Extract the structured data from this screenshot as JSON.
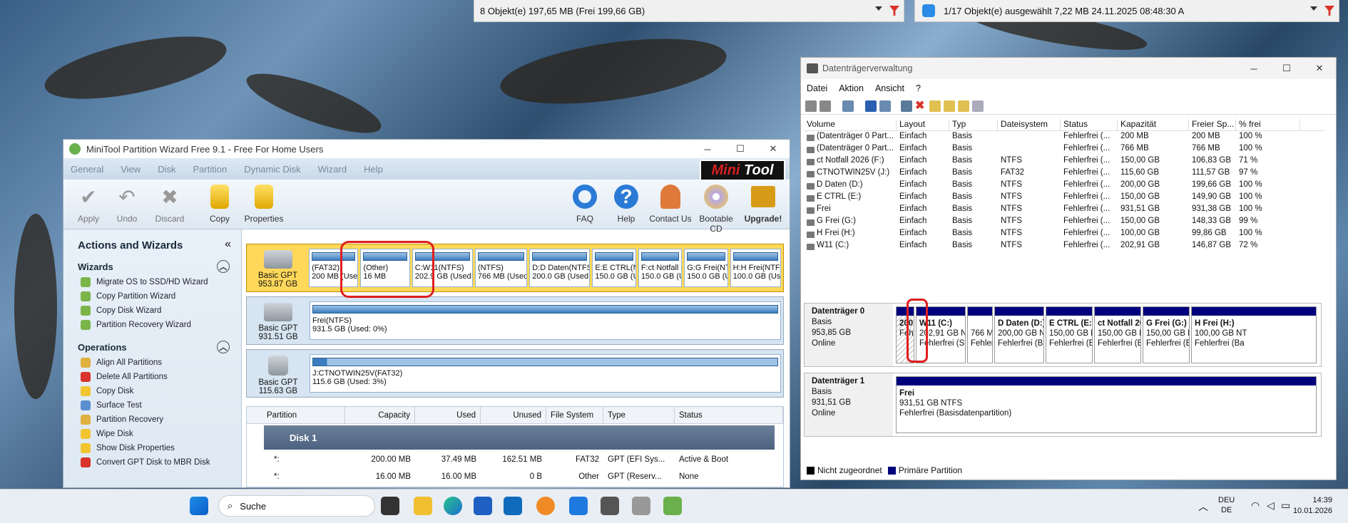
{
  "explorer_left": {
    "status": "8 Objekt(e)   197,65 MB   (Frei 199,66 GB)"
  },
  "explorer_right": {
    "status": "1/17 Objekt(e) ausgewählt   7,22 MB   24.11.2025 08:48:30   A"
  },
  "minitool": {
    "title": "MiniTool Partition Wizard Free 9.1 - Free For Home Users",
    "menu": [
      "General",
      "View",
      "Disk",
      "Partition",
      "Dynamic Disk",
      "Wizard",
      "Help"
    ],
    "logo_a": "Mini",
    "logo_b": "Tool",
    "toolbar": {
      "apply": "Apply",
      "undo": "Undo",
      "discard": "Discard",
      "copy": "Copy",
      "properties": "Properties",
      "faq": "FAQ",
      "help": "Help",
      "contact": "Contact Us",
      "bootable": "Bootable CD",
      "upgrade": "Upgrade!"
    },
    "side": {
      "title": "Actions and Wizards",
      "wizards": "Wizards",
      "wizard_items": [
        "Migrate OS to SSD/HD Wizard",
        "Copy Partition Wizard",
        "Copy Disk Wizard",
        "Partition Recovery Wizard"
      ],
      "operations": "Operations",
      "operation_items": [
        "Align All Partitions",
        "Delete All Partitions",
        "Copy Disk",
        "Surface Test",
        "Partition Recovery",
        "Wipe Disk",
        "Show Disk Properties",
        "Convert GPT Disk to MBR Disk"
      ]
    },
    "disks": [
      {
        "type": "Basic GPT",
        "size": "953.87 GB",
        "parts": [
          [
            "(FAT32)",
            "200 MB (Usec"
          ],
          [
            "(Other)",
            "16 MB"
          ],
          [
            "C:W11(NTFS)",
            "202.9 GB (Used:"
          ],
          [
            "(NTFS)",
            "766 MB (Usec"
          ],
          [
            "D:D Daten(NTFS",
            "200.0 GB (Used:"
          ],
          [
            "E:E CTRL(N",
            "150.0 GB (U"
          ],
          [
            "F:ct Notfall",
            "150.0 GB (U"
          ],
          [
            "G:G Frei(NT",
            "150.0 GB (U"
          ],
          [
            "H:H Frei(NTF",
            "100.0 GB (Use"
          ]
        ]
      },
      {
        "type": "Basic GPT",
        "size": "931.51 GB",
        "parts": [
          [
            "Frei(NTFS)",
            "931.5 GB (Used: 0%)"
          ]
        ]
      },
      {
        "type": "Basic GPT",
        "size": "115.63 GB",
        "parts": [
          [
            "J:CTNOTWIN25V(FAT32)",
            "115.6 GB (Used: 3%)"
          ]
        ]
      }
    ],
    "grid": {
      "headers": [
        "Partition",
        "Capacity",
        "Used",
        "Unused",
        "File System",
        "Type",
        "Status"
      ],
      "disk": "Disk 1",
      "rows": [
        [
          "*:",
          "200.00 MB",
          "37.49 MB",
          "162.51 MB",
          "FAT32",
          "GPT (EFI Sys...",
          "Active & Boot"
        ],
        [
          "*:",
          "16.00 MB",
          "16.00 MB",
          "0 B",
          "Other",
          "GPT (Reserv...",
          "None"
        ]
      ]
    }
  },
  "dm": {
    "title": "Datenträgerverwaltung",
    "menu": [
      "Datei",
      "Aktion",
      "Ansicht",
      "?"
    ],
    "headers": [
      "Volume",
      "Layout",
      "Typ",
      "Dateisystem",
      "Status",
      "Kapazität",
      "Freier Sp...",
      "% frei"
    ],
    "rows": [
      [
        "(Datenträger 0 Part...",
        "Einfach",
        "Basis",
        "",
        "Fehlerfrei (...",
        "200 MB",
        "200 MB",
        "100 %"
      ],
      [
        "(Datenträger 0 Part...",
        "Einfach",
        "Basis",
        "",
        "Fehlerfrei (...",
        "766 MB",
        "766 MB",
        "100 %"
      ],
      [
        "ct Notfall 2026 (F:)",
        "Einfach",
        "Basis",
        "NTFS",
        "Fehlerfrei (...",
        "150,00 GB",
        "106,83 GB",
        "71 %"
      ],
      [
        "CTNOTWIN25V (J:)",
        "Einfach",
        "Basis",
        "FAT32",
        "Fehlerfrei (...",
        "115,60 GB",
        "111,57 GB",
        "97 %"
      ],
      [
        "D Daten (D:)",
        "Einfach",
        "Basis",
        "NTFS",
        "Fehlerfrei (...",
        "200,00 GB",
        "199,66 GB",
        "100 %"
      ],
      [
        "E CTRL (E:)",
        "Einfach",
        "Basis",
        "NTFS",
        "Fehlerfrei (...",
        "150,00 GB",
        "149,90 GB",
        "100 %"
      ],
      [
        "Frei",
        "Einfach",
        "Basis",
        "NTFS",
        "Fehlerfrei (...",
        "931,51 GB",
        "931,38 GB",
        "100 %"
      ],
      [
        "G Frei (G:)",
        "Einfach",
        "Basis",
        "NTFS",
        "Fehlerfrei (...",
        "150,00 GB",
        "148,33 GB",
        "99 %"
      ],
      [
        "H Frei (H:)",
        "Einfach",
        "Basis",
        "NTFS",
        "Fehlerfrei (...",
        "100,00 GB",
        "99,86 GB",
        "100 %"
      ],
      [
        "W11 (C:)",
        "Einfach",
        "Basis",
        "NTFS",
        "Fehlerfrei (...",
        "202,91 GB",
        "146,87 GB",
        "72 %"
      ]
    ],
    "disk0": {
      "name": "Datenträger 0",
      "kind": "Basis",
      "size": "953,85 GB",
      "state": "Online",
      "parts": [
        [
          "200",
          "Fehl",
          ""
        ],
        [
          "W11  (C:)",
          "202,91 GB NTI",
          "Fehlerfrei (Sta"
        ],
        [
          "",
          "766 M",
          "Fehler"
        ],
        [
          "D Daten  (D:)",
          "200,00 GB NTI",
          "Fehlerfrei (Bas"
        ],
        [
          "E CTRL  (E:)",
          "150,00 GB NT",
          "Fehlerfrei (Ba"
        ],
        [
          "ct Notfall 20",
          "150,00 GB NT",
          "Fehlerfrei (Ba"
        ],
        [
          "G Frei  (G:)",
          "150,00 GB NT",
          "Fehlerfrei (Ba"
        ],
        [
          "H Frei  (H:)",
          "100,00 GB NT",
          "Fehlerfrei (Ba"
        ]
      ]
    },
    "disk1": {
      "name": "Datenträger 1",
      "kind": "Basis",
      "size": "931,51 GB",
      "state": "Online",
      "part_name": "Frei",
      "part_size": "931,51 GB NTFS",
      "part_status": "Fehlerfrei (Basisdatenpartition)"
    },
    "legend_a": "Nicht zugeordnet",
    "legend_b": "Primäre Partition"
  },
  "taskbar": {
    "search": "Suche",
    "lang1": "DEU",
    "lang2": "DE",
    "time": "14:39",
    "date": "10.01.2026"
  },
  "colors": {
    "highlight": "#e01e1e",
    "primary": "#00007c",
    "selected_disk": "#ffd85a"
  }
}
